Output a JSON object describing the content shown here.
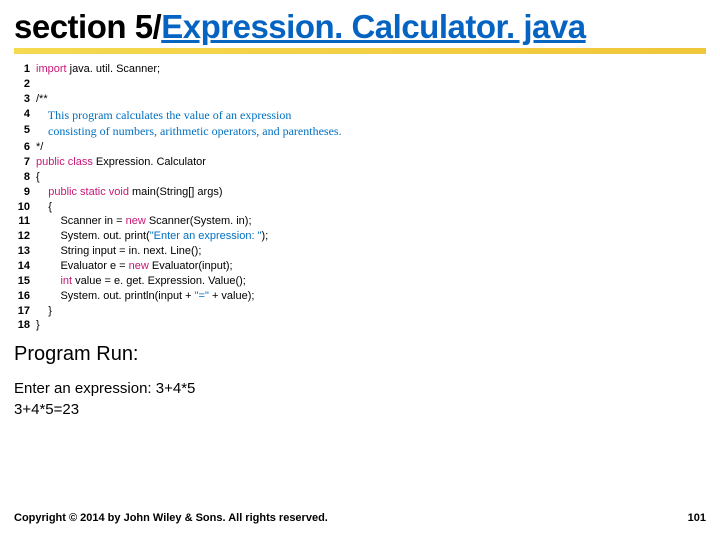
{
  "title": {
    "prefix": "section 5/",
    "link": "Expression. Calculator. java"
  },
  "code": {
    "lines": [
      {
        "n": 1,
        "segs": [
          {
            "t": "import",
            "c": "kw"
          },
          {
            "t": " java. util. Scanner;"
          }
        ]
      },
      {
        "n": 2,
        "segs": []
      },
      {
        "n": 3,
        "segs": [
          {
            "t": "/**"
          }
        ]
      },
      {
        "n": 4,
        "segs": [
          {
            "t": "    This program calculates the value of an expression",
            "c": "cm"
          }
        ]
      },
      {
        "n": 5,
        "segs": [
          {
            "t": "    consisting of numbers, arithmetic operators, and parentheses.",
            "c": "cm"
          }
        ]
      },
      {
        "n": 6,
        "segs": [
          {
            "t": "*/"
          }
        ]
      },
      {
        "n": 7,
        "segs": [
          {
            "t": "public class",
            "c": "kw"
          },
          {
            "t": " Expression. Calculator"
          }
        ]
      },
      {
        "n": 8,
        "segs": [
          {
            "t": "{"
          }
        ]
      },
      {
        "n": 9,
        "segs": [
          {
            "t": "    "
          },
          {
            "t": "public static void",
            "c": "kw"
          },
          {
            "t": " main(String[] args)"
          }
        ]
      },
      {
        "n": 10,
        "segs": [
          {
            "t": "    {"
          }
        ]
      },
      {
        "n": 11,
        "segs": [
          {
            "t": "        Scanner in = "
          },
          {
            "t": "new",
            "c": "kw"
          },
          {
            "t": " Scanner(System. in);"
          }
        ]
      },
      {
        "n": 12,
        "segs": [
          {
            "t": "        System. out. print("
          },
          {
            "t": "\"Enter an expression: \"",
            "c": "str"
          },
          {
            "t": ");"
          }
        ]
      },
      {
        "n": 13,
        "segs": [
          {
            "t": "        String input = in. next. Line();"
          }
        ]
      },
      {
        "n": 14,
        "segs": [
          {
            "t": "        Evaluator e = "
          },
          {
            "t": "new",
            "c": "kw"
          },
          {
            "t": " Evaluator(input);"
          }
        ]
      },
      {
        "n": 15,
        "segs": [
          {
            "t": "        "
          },
          {
            "t": "int",
            "c": "kw"
          },
          {
            "t": " value = e. get. Expression. Value();"
          }
        ]
      },
      {
        "n": 16,
        "segs": [
          {
            "t": "        System. out. println(input + "
          },
          {
            "t": "\"=\"",
            "c": "str"
          },
          {
            "t": " + value);"
          }
        ]
      },
      {
        "n": 17,
        "segs": [
          {
            "t": "    }"
          }
        ]
      },
      {
        "n": 18,
        "segs": [
          {
            "t": "}"
          }
        ]
      }
    ]
  },
  "run_heading": "Program Run:",
  "run": {
    "line1_prompt": "Enter an expression: ",
    "line1_input": "3+4*5",
    "line2": "3+4*5=23"
  },
  "footer": {
    "copyright": "Copyright © 2014 by John Wiley & Sons. All rights reserved.",
    "page": "101"
  }
}
